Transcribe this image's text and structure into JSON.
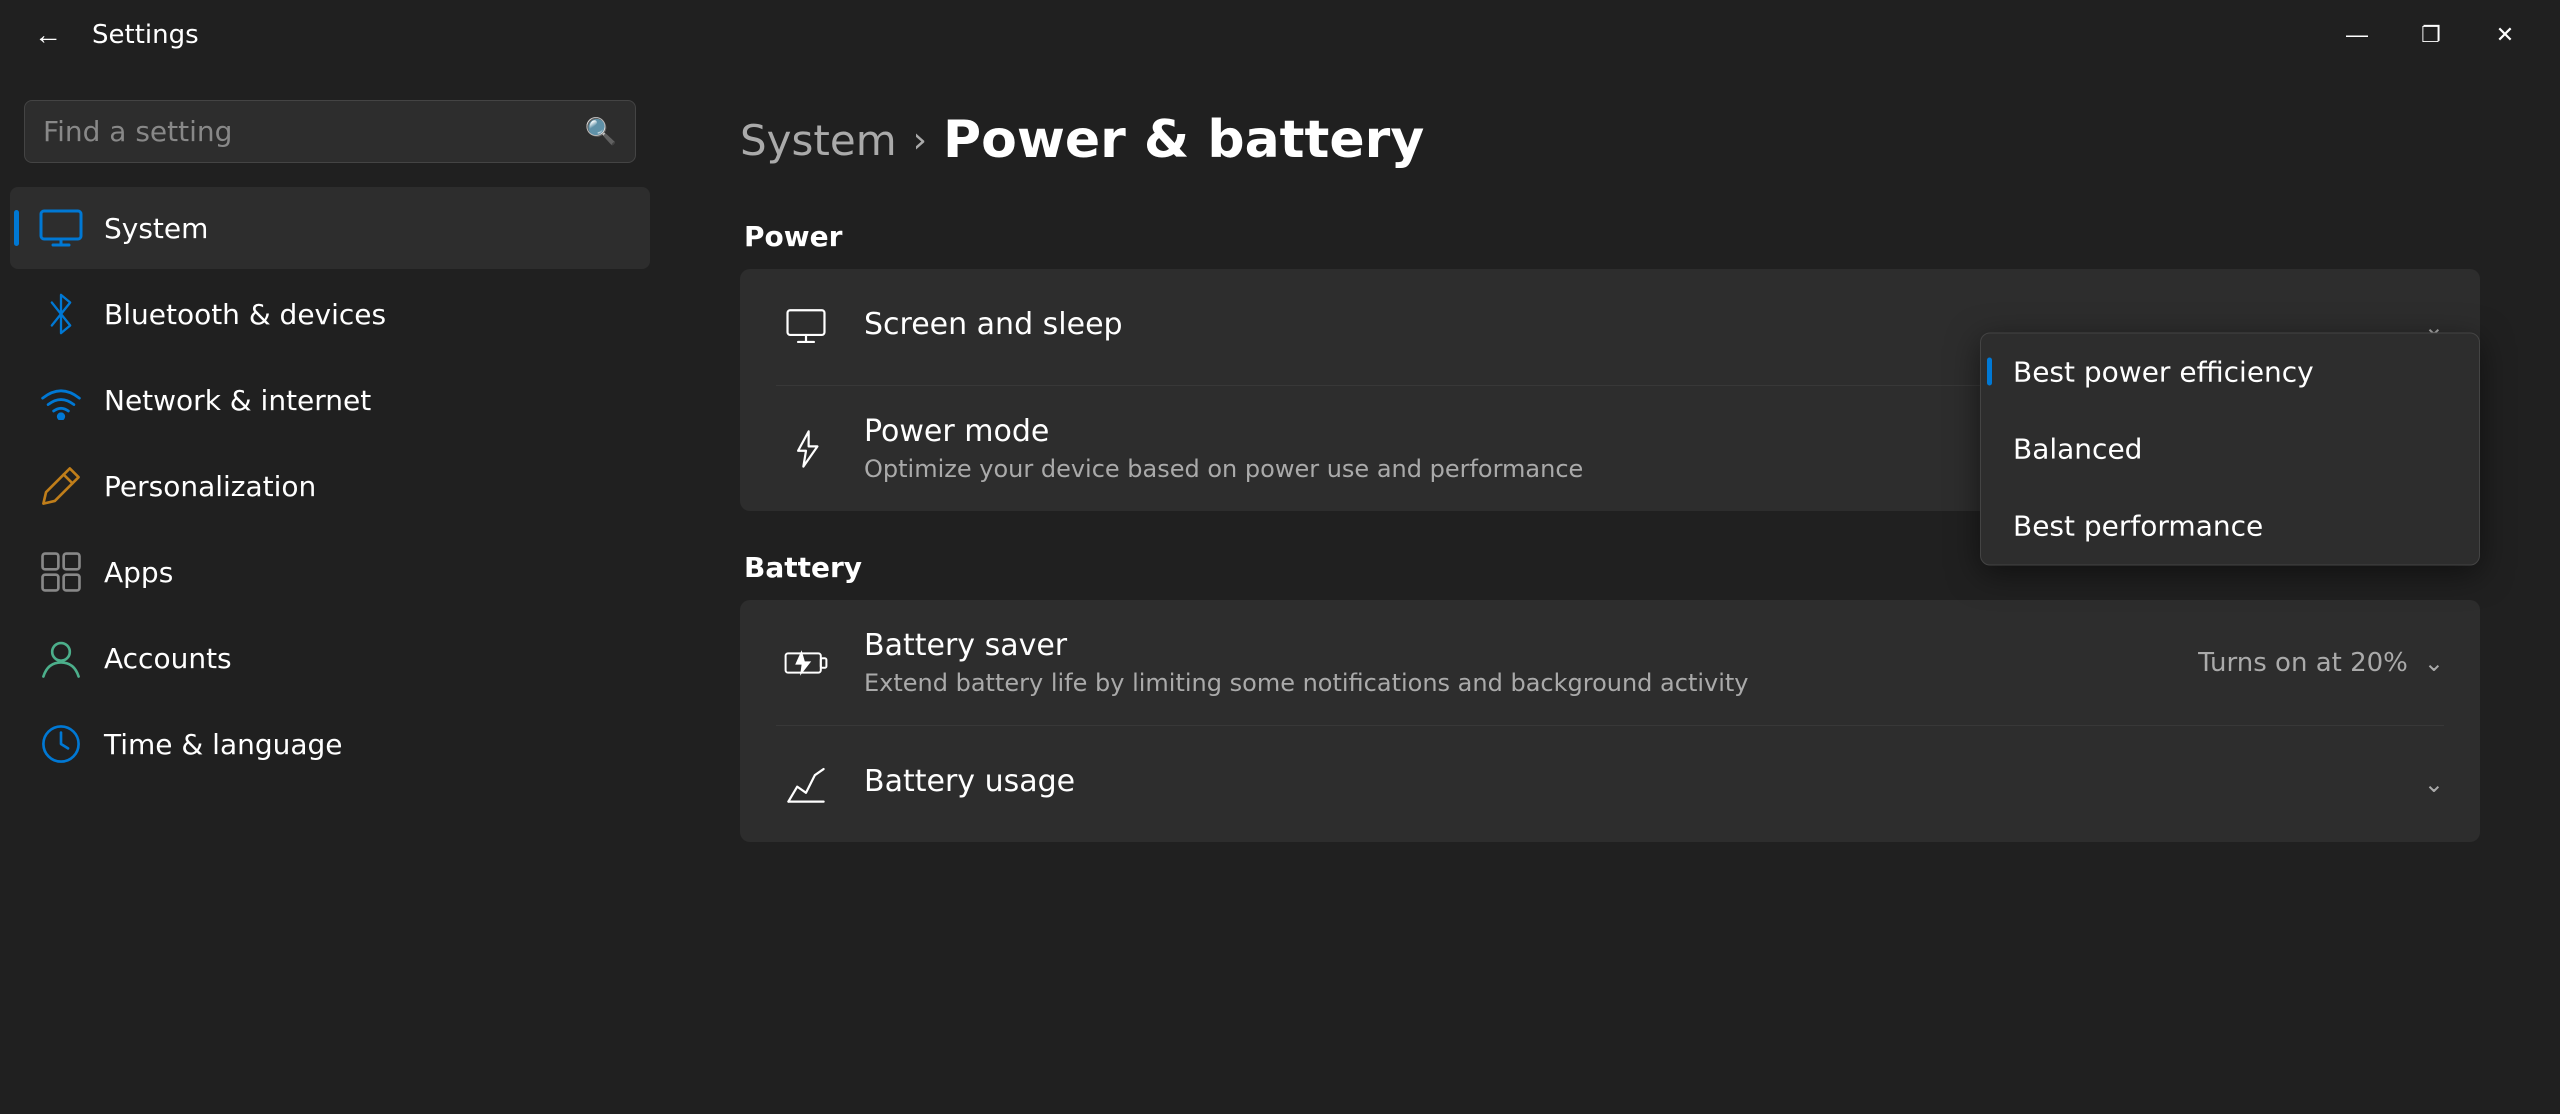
{
  "window": {
    "title": "Settings",
    "back_label": "←",
    "minimize": "—",
    "maximize": "❐",
    "close": "✕"
  },
  "sidebar": {
    "search_placeholder": "Find a setting",
    "search_label": "Find a setting",
    "items": [
      {
        "id": "system",
        "label": "System",
        "icon": "system",
        "active": true
      },
      {
        "id": "bluetooth",
        "label": "Bluetooth & devices",
        "icon": "bluetooth",
        "active": false
      },
      {
        "id": "network",
        "label": "Network & internet",
        "icon": "wifi",
        "active": false
      },
      {
        "id": "personalization",
        "label": "Personalization",
        "icon": "pen",
        "active": false
      },
      {
        "id": "apps",
        "label": "Apps",
        "icon": "apps",
        "active": false
      },
      {
        "id": "accounts",
        "label": "Accounts",
        "icon": "accounts",
        "active": false
      },
      {
        "id": "time",
        "label": "Time & language",
        "icon": "time",
        "active": false
      }
    ]
  },
  "breadcrumb": {
    "parent": "System",
    "separator": "›",
    "current": "Power & battery"
  },
  "content": {
    "power_section": "Power",
    "battery_section": "Battery",
    "rows": [
      {
        "id": "screen-sleep",
        "title": "Screen and sleep",
        "subtitle": "",
        "right": "",
        "show_chevron": true
      },
      {
        "id": "power-mode",
        "title": "Power mode",
        "subtitle": "Optimize your device based on power use and performance",
        "right": "",
        "show_chevron": false,
        "show_dropdown": true
      },
      {
        "id": "battery-saver",
        "title": "Battery saver",
        "subtitle": "Extend battery life by limiting some notifications and background activity",
        "right": "Turns on at 20%",
        "show_chevron": true
      },
      {
        "id": "battery-usage",
        "title": "Battery usage",
        "subtitle": "",
        "right": "",
        "show_chevron": true
      }
    ],
    "dropdown": {
      "items": [
        {
          "label": "Best power efficiency",
          "selected": true
        },
        {
          "label": "Balanced",
          "selected": false
        },
        {
          "label": "Best performance",
          "selected": false
        }
      ]
    }
  }
}
